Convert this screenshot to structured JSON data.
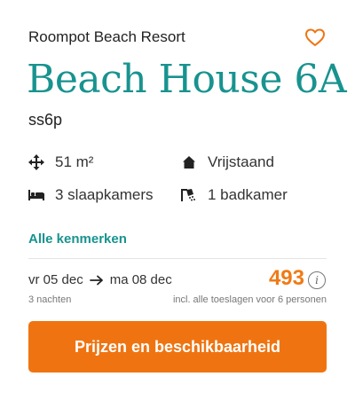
{
  "card": {
    "park_name": "Roompot Beach Resort",
    "favorite_icon": "heart-outline-icon",
    "title": "Beach House 6A",
    "code": "ss6p",
    "features": [
      {
        "icon": "area-arrows-icon",
        "label": "51 m²"
      },
      {
        "icon": "house-icon",
        "label": "Vrijstaand"
      },
      {
        "icon": "bed-icon",
        "label": "3 slaapkamers"
      },
      {
        "icon": "shower-icon",
        "label": "1 badkamer"
      }
    ],
    "all_features_link": "Alle kenmerken",
    "stay": {
      "from": "vr 05 dec",
      "to": "ma 08 dec",
      "nights": "3 nachten"
    },
    "price": {
      "amount": "493",
      "info_icon": "info-icon",
      "note": "incl. alle toeslagen voor 6 personen"
    },
    "cta_label": "Prijzen en beschikbaarheid"
  },
  "colors": {
    "accent_teal": "#18938f",
    "accent_orange": "#ef7411"
  }
}
